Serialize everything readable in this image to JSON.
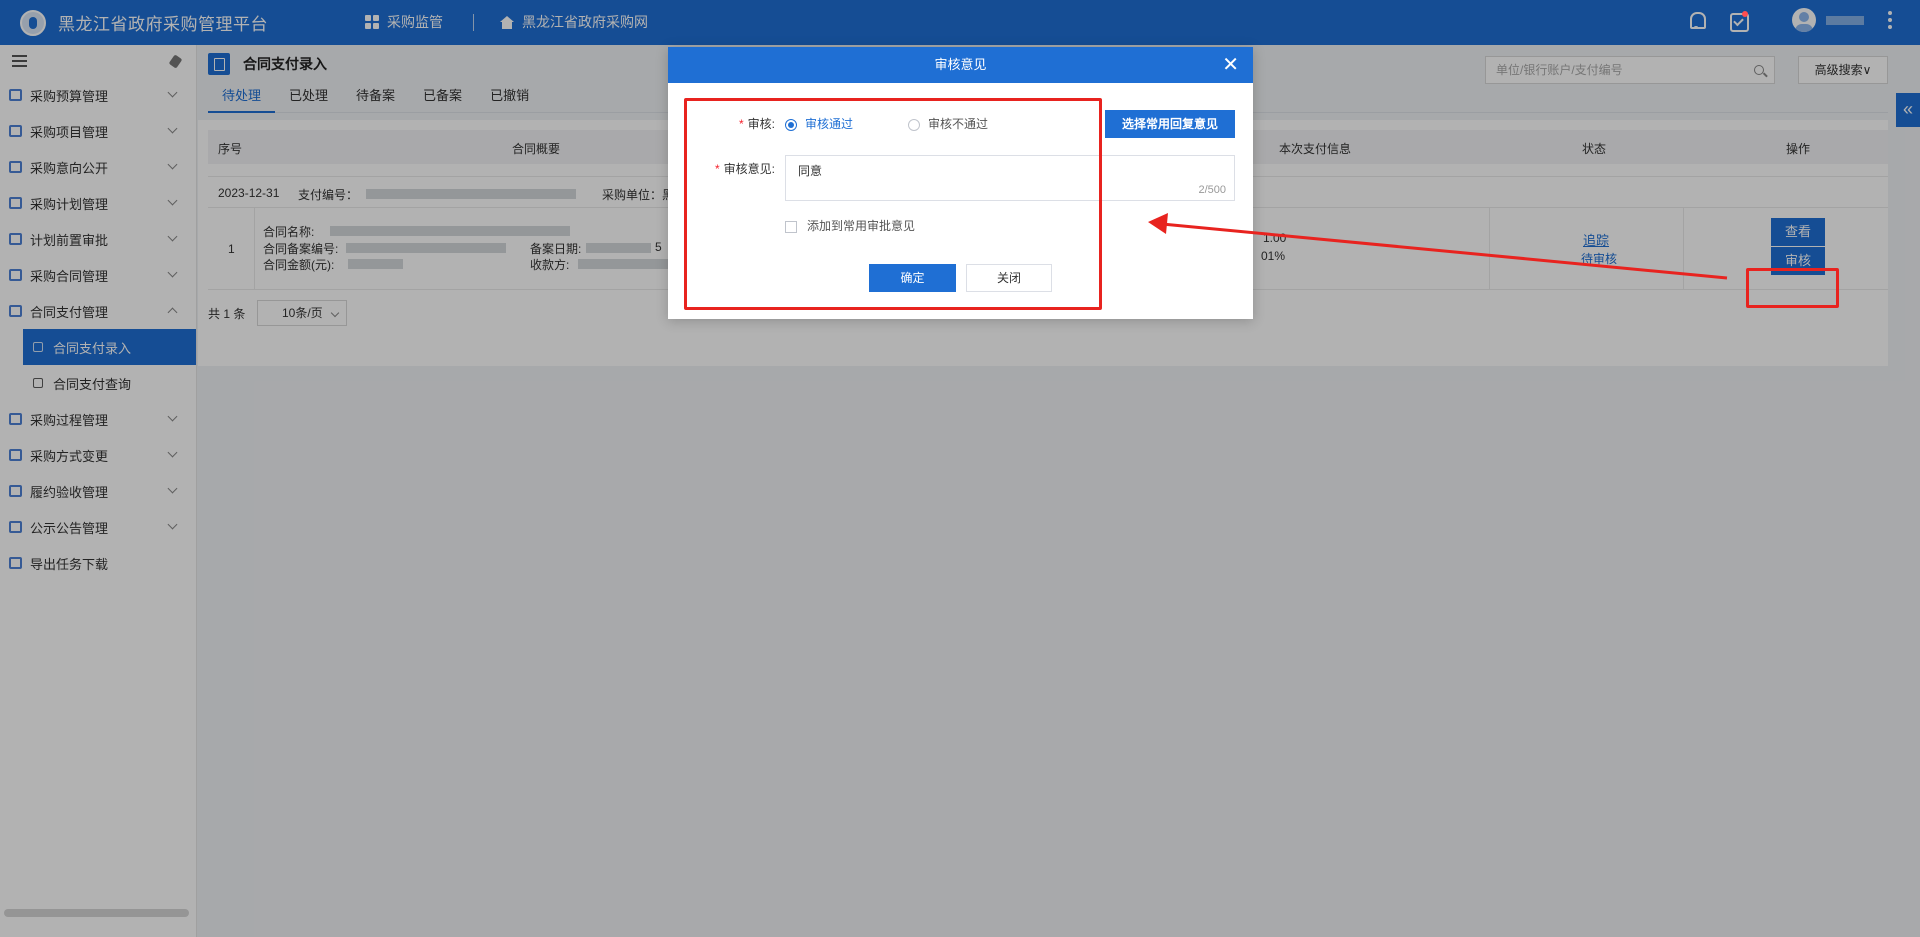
{
  "header": {
    "app_title": "黑龙江省政府采购管理平台",
    "nav": [
      "采购监管",
      "黑龙江省政府采购网"
    ],
    "user_name": ""
  },
  "sidebar": {
    "items": [
      {
        "label": "采购预算管理",
        "expanded": false
      },
      {
        "label": "采购项目管理",
        "expanded": false
      },
      {
        "label": "采购意向公开",
        "expanded": false
      },
      {
        "label": "采购计划管理",
        "expanded": false
      },
      {
        "label": "计划前置审批",
        "expanded": false
      },
      {
        "label": "采购合同管理",
        "expanded": false
      },
      {
        "label": "合同支付管理",
        "expanded": true
      },
      {
        "label": "采购过程管理",
        "expanded": false
      },
      {
        "label": "采购方式变更",
        "expanded": false
      },
      {
        "label": "履约验收管理",
        "expanded": false
      },
      {
        "label": "公示公告管理",
        "expanded": false
      },
      {
        "label": "导出任务下载",
        "expanded": false
      }
    ],
    "subitems": [
      "合同支付录入",
      "合同支付查询"
    ],
    "active_subitem": "合同支付录入"
  },
  "page": {
    "title": "合同支付录入",
    "tabs": [
      "待处理",
      "已处理",
      "待备案",
      "已备案",
      "已撤销"
    ],
    "active_tab": "待处理",
    "search_placeholder": "单位/银行账户/支付编号",
    "advanced_search": "高级搜索∨"
  },
  "table": {
    "headers": [
      "序号",
      "合同概要",
      "本次支付信息",
      "状态",
      "操作"
    ],
    "group": {
      "date": "2023-12-31",
      "pay_no_label": "支付编号：",
      "unit_label": "采购单位：黑"
    },
    "row": {
      "index": "1",
      "contract_name_label": "合同名称:",
      "record_no_label": "合同备案编号:",
      "record_date_label": "备案日期:",
      "record_date_tail": "5",
      "amount_label": "合同金额(元):",
      "payee_label": "收款方:",
      "pay_amount": "1.00",
      "pay_ratio": "01%",
      "track_link": "追踪",
      "status": "待审核",
      "view_btn": "查看",
      "review_btn": "审核"
    }
  },
  "pager": {
    "total": "共 1 条",
    "page_size": "10条/页"
  },
  "modal": {
    "title": "审核意见",
    "review_label": "审核:",
    "option_pass": "审核通过",
    "option_fail": "审核不通过",
    "selected": "审核通过",
    "common_reply_btn": "选择常用回复意见",
    "opinion_label": "审核意见:",
    "opinion_value": "同意",
    "char_count": "2/500",
    "add_common_label": "添加到常用审批意见",
    "add_common_checked": false,
    "ok_btn": "确定",
    "close_btn": "关闭"
  },
  "colors": {
    "primary": "#1f6fd4",
    "annotation": "#e8231f"
  }
}
